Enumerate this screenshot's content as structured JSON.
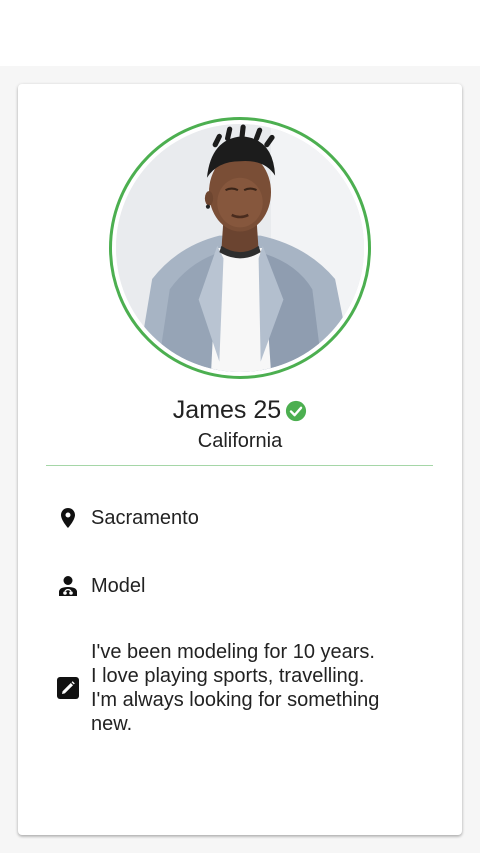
{
  "profile": {
    "name_age": "James 25",
    "verified": true,
    "region": "California",
    "photo": "profile-photo-man-in-grey-blazer"
  },
  "details": {
    "city": {
      "icon": "location-pin-icon",
      "text": "Sacramento"
    },
    "occupation": {
      "icon": "person-badge-icon",
      "text": "Model"
    },
    "bio": {
      "icon": "edit-pencil-icon",
      "lines": [
        "I've been modeling for 10 years.",
        "I love playing sports, travelling.",
        "I'm always looking for something",
        "new."
      ]
    }
  },
  "colors": {
    "accent": "#4caf50",
    "divider": "#a5d6a7",
    "text": "#222222",
    "background": "#f6f6f6",
    "card": "#ffffff"
  }
}
